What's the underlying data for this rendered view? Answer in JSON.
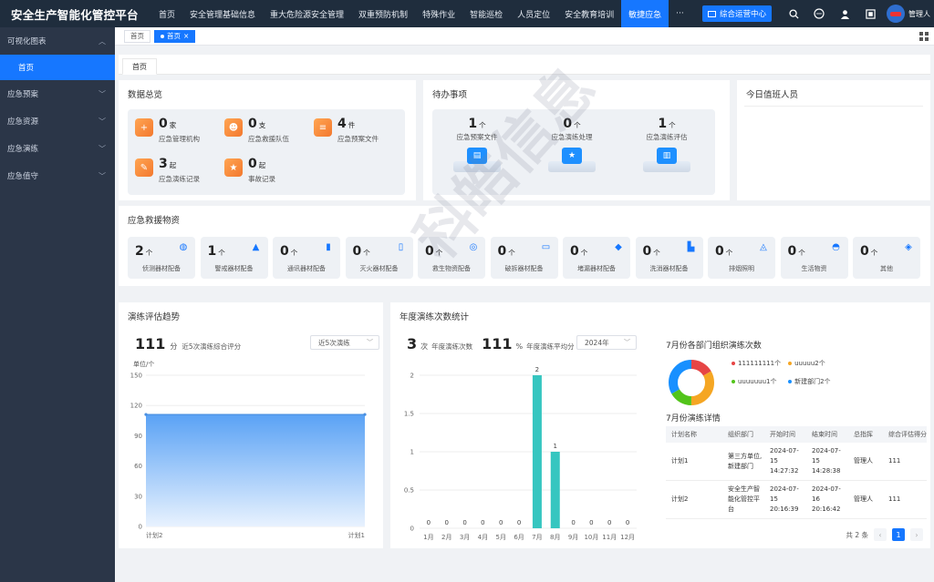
{
  "app": {
    "title": "安全生产智能化管控平台"
  },
  "topnav": {
    "items": [
      "首页",
      "安全管理基础信息",
      "重大危险源安全管理",
      "双重预防机制",
      "特殊作业",
      "智能巡检",
      "人员定位",
      "安全教育培训",
      "敏捷应急",
      "···"
    ],
    "active_index": 8
  },
  "topbar": {
    "ops_button": "综合运营中心",
    "user": "管理人"
  },
  "sidebar": {
    "groups": [
      {
        "label": "可视化图表",
        "expanded": true,
        "children": [
          "首页"
        ]
      },
      {
        "label": "应急预案"
      },
      {
        "label": "应急资源"
      },
      {
        "label": "应急演练"
      },
      {
        "label": "应急值守"
      }
    ]
  },
  "tabs": {
    "items": [
      "首页",
      "首页"
    ],
    "close": "×"
  },
  "subtab": {
    "label": "首页"
  },
  "overview": {
    "title": "数据总览",
    "items": [
      {
        "value": "0",
        "unit": "家",
        "label": "应急管理机构",
        "icon": "plus-icon"
      },
      {
        "value": "0",
        "unit": "支",
        "label": "应急救援队伍",
        "icon": "team-icon"
      },
      {
        "value": "4",
        "unit": "件",
        "label": "应急预案文件",
        "icon": "document-icon"
      },
      {
        "value": "3",
        "unit": "起",
        "label": "应急演练记录",
        "icon": "edit-icon"
      },
      {
        "value": "0",
        "unit": "起",
        "label": "事故记录",
        "icon": "runner-icon"
      }
    ]
  },
  "todo": {
    "title": "待办事项",
    "items": [
      {
        "value": "1",
        "unit": "个",
        "label": "应急预案文件",
        "icon": "file-icon"
      },
      {
        "value": "0",
        "unit": "个",
        "label": "应急演练处理",
        "icon": "runner-icon"
      },
      {
        "value": "1",
        "unit": "个",
        "label": "应急演练评估",
        "icon": "report-icon"
      }
    ]
  },
  "duty": {
    "title": "今日值班人员"
  },
  "supplies": {
    "title": "应急救援物资",
    "items": [
      {
        "value": "2",
        "unit": "个",
        "label": "侦测器材配备"
      },
      {
        "value": "1",
        "unit": "个",
        "label": "警戒器材配备"
      },
      {
        "value": "0",
        "unit": "个",
        "label": "通讯器材配备"
      },
      {
        "value": "0",
        "unit": "个",
        "label": "灭火器材配备"
      },
      {
        "value": "0",
        "unit": "个",
        "label": "救生物资配备"
      },
      {
        "value": "0",
        "unit": "个",
        "label": "破拆器材配备"
      },
      {
        "value": "0",
        "unit": "个",
        "label": "堵漏器材配备"
      },
      {
        "value": "0",
        "unit": "个",
        "label": "洗消器材配备"
      },
      {
        "value": "0",
        "unit": "个",
        "label": "排烟照明"
      },
      {
        "value": "0",
        "unit": "个",
        "label": "生活物资"
      },
      {
        "value": "0",
        "unit": "个",
        "label": "其他"
      }
    ]
  },
  "trend": {
    "title": "演练评估趋势",
    "score": "111",
    "score_unit": "分",
    "score_label": "近5次演练综合评分",
    "select": "近5次演练",
    "y_unit": "单位/个"
  },
  "annual": {
    "title": "年度演练次数统计",
    "count": "3",
    "count_unit": "次",
    "count_label": "年度演练次数",
    "avg": "111",
    "avg_unit": "%",
    "avg_label": "年度演练平均分",
    "year_select": "2024年"
  },
  "dept": {
    "title": "7月份各部门组织演练次数",
    "legend": [
      {
        "label": "111111111个",
        "color": "#e64545"
      },
      {
        "label": "uuuuu2个",
        "color": "#f5a623"
      },
      {
        "label": "uuuuuuu1个",
        "color": "#52c41a"
      },
      {
        "label": "新建部门2个",
        "color": "#1890ff"
      }
    ]
  },
  "details": {
    "title": "7月份演练详情",
    "columns": [
      "计划名称",
      "组织部门",
      "开始时间",
      "结束时间",
      "总指挥",
      "综合评估得分"
    ],
    "rows": [
      [
        "计划1",
        "第三方单位,新建部门",
        "2024-07-15 14:27:32",
        "2024-07-15 14:28:38",
        "管理人",
        "111"
      ],
      [
        "计划2",
        "安全生产智能化管控平台",
        "2024-07-15 20:16:39",
        "2024-07-16 20:16:42",
        "管理人",
        "111"
      ]
    ],
    "total": "共 2 条",
    "page": "1",
    "prev": "‹",
    "next": "›"
  },
  "watermark": "科皓信息",
  "chart_data": [
    {
      "type": "area",
      "title": "演练评估趋势",
      "ylabel": "单位/个",
      "categories": [
        "计划2",
        "计划1"
      ],
      "values": [
        111,
        111
      ],
      "ylim": [
        0,
        150
      ],
      "yticks": [
        0,
        30,
        60,
        90,
        120,
        150
      ]
    },
    {
      "type": "bar",
      "title": "年度演练次数统计",
      "categories": [
        "1月",
        "2月",
        "3月",
        "4月",
        "5月",
        "6月",
        "7月",
        "8月",
        "9月",
        "10月",
        "11月",
        "12月"
      ],
      "values": [
        0,
        0,
        0,
        0,
        0,
        0,
        2,
        1,
        0,
        0,
        0,
        0
      ],
      "ylim": [
        0,
        2
      ],
      "yticks": [
        0,
        0.5,
        1,
        1.5,
        2
      ]
    },
    {
      "type": "pie",
      "title": "7月份各部门组织演练次数",
      "categories": [
        "111111111",
        "uuuuu",
        "uuuuuuu",
        "新建部门"
      ],
      "values": [
        1,
        2,
        1,
        2
      ]
    }
  ]
}
